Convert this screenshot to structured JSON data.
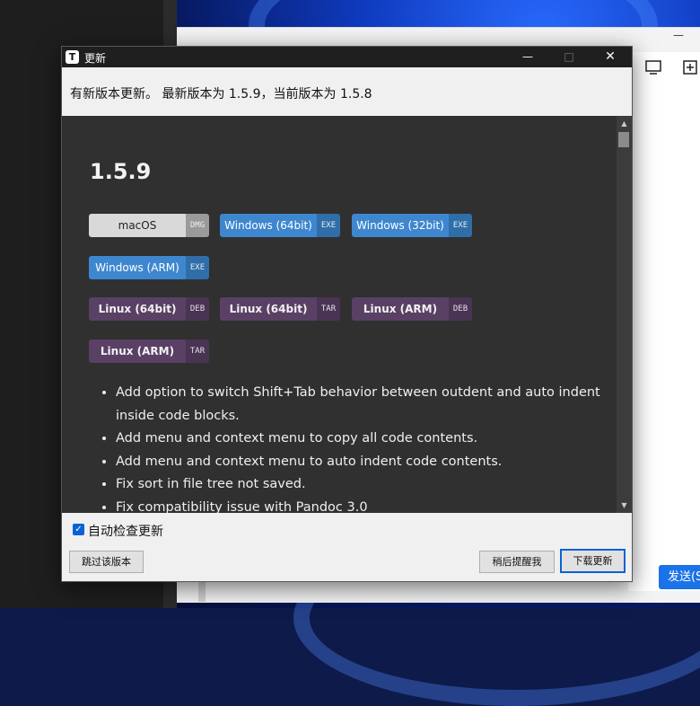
{
  "background": {
    "send_button": "发送(S",
    "minimize_glyph": "—"
  },
  "dialog": {
    "title": "更新",
    "app_icon_letter": "T",
    "controls": {
      "minimize": "—",
      "maximize": "□",
      "close": "✕"
    },
    "header_message": "有新版本更新。 最新版本为 1.5.9，当前版本为 1.5.8",
    "release": {
      "version": "1.5.9",
      "downloads": [
        {
          "label": "macOS",
          "ext": "DMG",
          "style": "gray"
        },
        {
          "label": "Windows (64bit)",
          "ext": "EXE",
          "style": "blue"
        },
        {
          "label": "Windows (32bit)",
          "ext": "EXE",
          "style": "blue"
        },
        {
          "label": "Windows (ARM)",
          "ext": "EXE",
          "style": "blue"
        },
        {
          "label": "Linux (64bit)",
          "ext": "DEB",
          "style": "purple"
        },
        {
          "label": "Linux (64bit)",
          "ext": "TAR",
          "style": "purple"
        },
        {
          "label": "Linux (ARM)",
          "ext": "DEB",
          "style": "purple"
        },
        {
          "label": "Linux (ARM)",
          "ext": "TAR",
          "style": "purple"
        }
      ],
      "notes": [
        "Add option to switch Shift+Tab behavior between outdent and auto indent inside code blocks.",
        "Add menu and context menu to copy all code contents.",
        "Add menu and context menu to auto indent code contents.",
        "Fix sort in file tree not saved.",
        "Fix compatibility issue with Pandoc 3.0"
      ]
    },
    "footer": {
      "auto_check_label": "自动检查更新",
      "auto_check_checked": true,
      "skip_button": "跳过该版本",
      "later_button": "稍后提醒我",
      "download_button": "下载更新"
    }
  }
}
